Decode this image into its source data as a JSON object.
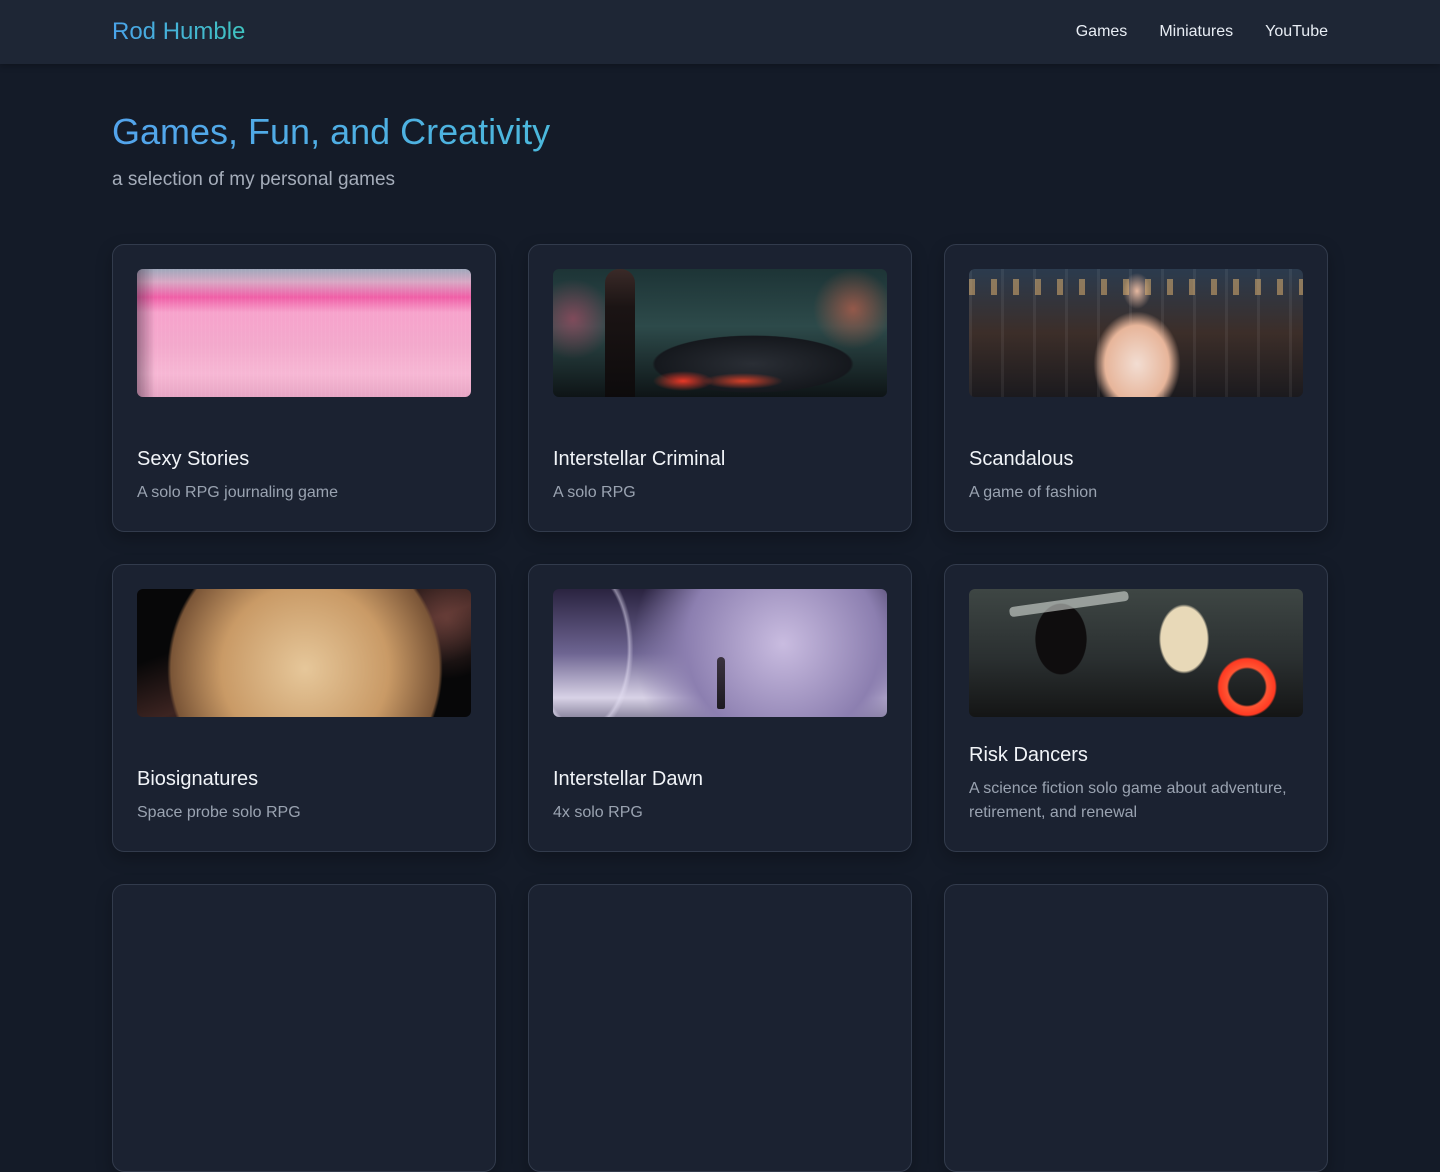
{
  "header": {
    "brand": "Rod Humble",
    "nav": [
      {
        "label": "Games"
      },
      {
        "label": "Miniatures"
      },
      {
        "label": "YouTube"
      }
    ]
  },
  "hero": {
    "title": "Games, Fun, and Creativity",
    "subtitle": "a selection of my personal games"
  },
  "cards": [
    {
      "title": "Sexy Stories",
      "description": "A solo RPG journaling game"
    },
    {
      "title": "Interstellar Criminal",
      "description": "A solo RPG"
    },
    {
      "title": "Scandalous",
      "description": "A game of fashion"
    },
    {
      "title": "Biosignatures",
      "description": "Space probe solo RPG"
    },
    {
      "title": "Interstellar Dawn",
      "description": "4x solo RPG"
    },
    {
      "title": "Risk Dancers",
      "description": "A science fiction solo game about adventure, retirement, and renewal"
    }
  ],
  "colors": {
    "background": "#141b28",
    "navbar": "#1e2635",
    "card": "#1b2231",
    "accent": "#4aa3ea"
  }
}
